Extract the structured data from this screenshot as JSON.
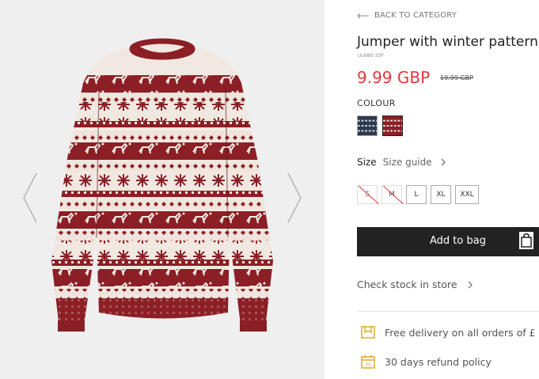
{
  "nav": {
    "back_label": "BACK TO CATEGORY"
  },
  "product": {
    "title": "Jumper with winter pattern",
    "sku": "UL680-33P",
    "price": "9.99 GBP",
    "old_price": "19.99 GBP"
  },
  "colour": {
    "label": "COLOUR",
    "swatches": [
      {
        "name": "navy pattern",
        "color": "#2e3a4c"
      },
      {
        "name": "burgundy pattern",
        "color": "#8c1f26"
      }
    ]
  },
  "size": {
    "label": "Size",
    "guide_label": "Size guide",
    "options": [
      {
        "label": "S",
        "available": false
      },
      {
        "label": "M",
        "available": false
      },
      {
        "label": "L",
        "available": true
      },
      {
        "label": "XL",
        "available": true
      },
      {
        "label": "XXL",
        "available": true
      }
    ]
  },
  "actions": {
    "add_to_bag": "Add to bag",
    "check_stock": "Check stock in store"
  },
  "perks": {
    "delivery": "Free delivery on all orders of £",
    "refund": "30 days refund policy"
  },
  "colors": {
    "price_red": "#e2383c",
    "button_dark": "#222222",
    "sweater_red": "#8c1f26",
    "sweater_cream": "#f1e9e1",
    "perk_icon": "#e1a92c"
  }
}
